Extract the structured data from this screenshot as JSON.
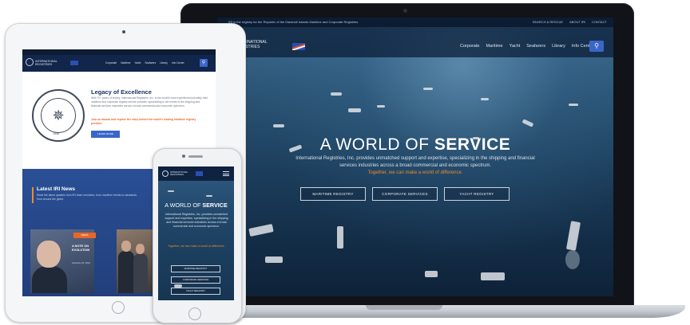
{
  "laptop": {
    "topbar_message": "IRI is the registry for the Republic of the Marshall Islands Maritime and Corporate Registries",
    "topbar_links": [
      "SEARCH & RESCUE",
      "ABOUT IRI",
      "CONTACT"
    ],
    "logo_text": "INTERNATIONAL REGISTRIES",
    "menu": [
      "Corporate",
      "Maritime",
      "Yacht",
      "Seafarers",
      "Library",
      "Info Center"
    ],
    "search_icon": "⚲",
    "hero": {
      "title_light": "A WORLD OF ",
      "title_bold": "SERVICE",
      "body": "International Registries, Inc. provides unmatched support and expertise, specializing in the shipping and financial services industries across a broad commercial and economic spectrum.",
      "tagline": "Together, we can make a world of difference."
    },
    "buttons": [
      "MARITIME REGISTRY",
      "CORPORATE SERVICES",
      "YACHT REGISTRY"
    ]
  },
  "tablet": {
    "logo_text": "INTERNATIONAL REGISTRIES",
    "menu": [
      "Corporate",
      "Maritime",
      "Yacht",
      "Seafarers",
      "Library",
      "Info Center"
    ],
    "search_icon": "⚲",
    "seal_year": "1948",
    "seal_symbol": "✵",
    "legacy": {
      "title": "Legacy of Excellence",
      "body": "With 70+ years of history, International Registries, Inc. is the world's most experienced privately held maritime and corporate registry service provider, specializing in the needs of the shipping and financial services industries across a broad commercial and economic spectrum.",
      "cta": "Join us aboard and explore the story behind the world's leading maritime registry provider.",
      "button": "LEARN MORE"
    },
    "news": {
      "title": "Latest IRI News",
      "body": "Read the latest updates from IRI team members, from maritime trends to standards from around the globe."
    },
    "card": {
      "tag": "NEWS",
      "title": "A NOTE ON EVOLUTION",
      "date": "February 23, 2024"
    }
  },
  "phone": {
    "logo_text": "INTERNATIONAL REGISTRIES",
    "hero": {
      "title_light": "A WORLD OF ",
      "title_bold": "SERVICE",
      "body": "International Registries, Inc. provides unmatched support and expertise, specializing in the shipping and financial services industries across a broad commercial and economic spectrum.",
      "tagline": "Together, we can make a world of difference."
    },
    "buttons": [
      "MARITIME REGISTRY",
      "CORPORATE SERVICES",
      "YACHT REGISTRY"
    ]
  }
}
